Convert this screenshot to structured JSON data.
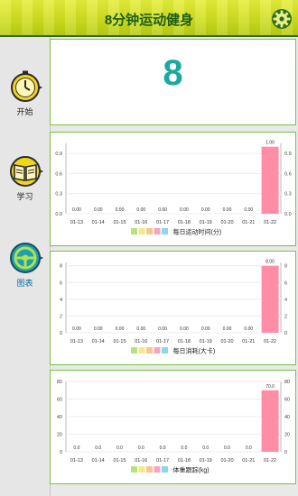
{
  "header": {
    "title": "8分钟运动健身",
    "settings_icon": "gear-icon"
  },
  "sidebar": {
    "items": [
      {
        "label": "开始",
        "icon": "stopwatch-icon"
      },
      {
        "label": "学习",
        "icon": "book-icon"
      },
      {
        "label": "图表",
        "icon": "steering-wheel-icon",
        "active": true
      }
    ]
  },
  "main": {
    "big_number": "8"
  },
  "colors": {
    "bar": "#ff8da5",
    "accent": "#1aa9a0",
    "legend": [
      "#b6e37c",
      "#f4e98a",
      "#f8c58e",
      "#f6a4c1",
      "#8ad8ef"
    ]
  },
  "chart_data": [
    {
      "type": "bar",
      "categories": [
        "01-13",
        "01-14",
        "01-15",
        "01-16",
        "01-17",
        "01-18",
        "01-19",
        "01-20",
        "01-21",
        "01-22"
      ],
      "values": [
        0,
        0,
        0,
        0,
        0,
        0,
        0,
        0,
        0,
        1.0
      ],
      "value_labels": [
        "0.00",
        "0.00",
        "0.00",
        "0.00",
        "0.00",
        "0.00",
        "0.00",
        "0.00",
        "0.00",
        "1.00"
      ],
      "yticks": [
        "0.0",
        "0.3",
        "0.6",
        "0.9"
      ],
      "ytick_values": [
        0,
        0.3,
        0.6,
        0.9
      ],
      "ylim": [
        0,
        1.05
      ],
      "legend": "每日运动时间(分)"
    },
    {
      "type": "bar",
      "categories": [
        "01-13",
        "01-14",
        "01-15",
        "01-16",
        "01-17",
        "01-18",
        "01-19",
        "01-20",
        "01-21",
        "01-22"
      ],
      "values": [
        0,
        0,
        0,
        0,
        0,
        0,
        0,
        0,
        0,
        8.0
      ],
      "value_labels": [
        "0.00",
        "0.00",
        "0.00",
        "0.00",
        "0.00",
        "0.00",
        "0.00",
        "0.00",
        "0.00",
        "8.00"
      ],
      "yticks": [
        "0",
        "2",
        "4",
        "6",
        "8"
      ],
      "ytick_values": [
        0,
        2,
        4,
        6,
        8
      ],
      "ylim": [
        0,
        8.4
      ],
      "legend": "每日消耗(大卡)"
    },
    {
      "type": "bar",
      "categories": [
        "01-13",
        "01-14",
        "01-15",
        "01-16",
        "01-17",
        "01-18",
        "01-19",
        "01-20",
        "01-21",
        "01-22"
      ],
      "values": [
        0,
        0,
        0,
        0,
        0,
        0,
        0,
        0,
        0,
        70.0
      ],
      "value_labels": [
        "0.0",
        "0.0",
        "0.0",
        "0.0",
        "0.0",
        "0.0",
        "0.0",
        "0.0",
        "0.0",
        "70.0"
      ],
      "yticks": [
        "0",
        "20",
        "40",
        "60",
        "80"
      ],
      "ytick_values": [
        0,
        20,
        40,
        60,
        80
      ],
      "ylim": [
        0,
        80
      ],
      "legend": "体重跟踪(kg)"
    }
  ]
}
